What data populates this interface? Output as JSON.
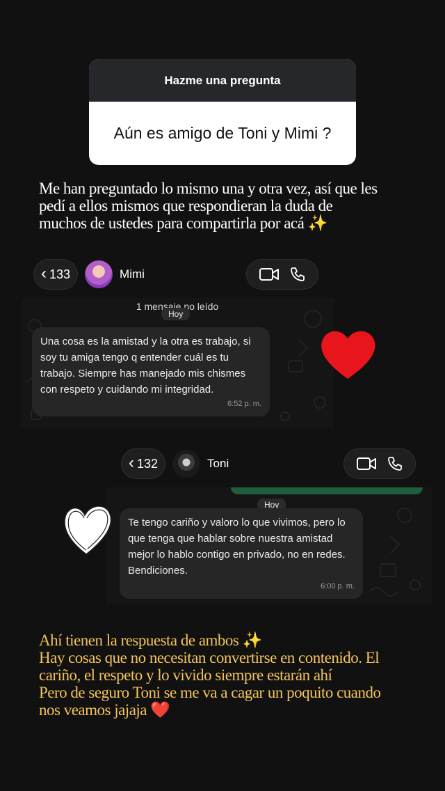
{
  "question_card": {
    "title": "Hazme una pregunta",
    "question": "Aún es amigo de Toni y Mimi ?"
  },
  "intro_caption": {
    "lines": [
      "Me han preguntado lo mismo una y otra vez, así que les",
      "pedí a ellos mismos que respondieran la duda de",
      "muchos de ustedes para compartirla por acá ✨"
    ]
  },
  "chat_mimi": {
    "back_count": "133",
    "contact_name": "Mimi",
    "unread_label": "1 mensaje no leído",
    "day_label": "Hoy",
    "message": "Una cosa es la amistad y la otra es trabajo, si soy tu amiga tengo q entender cuál es tu trabajo. Siempre has manejado mis chismes con respeto y cuidando mi integridad.",
    "time": "6:52 p. m."
  },
  "chat_toni": {
    "back_count": "132",
    "contact_name": "Toni",
    "day_label": "Hoy",
    "message": "Te tengo cariño y valoro lo que vivimos, pero lo que tenga que hablar sobre nuestra amistad mejor lo hablo contigo en privado, no en redes. Bendiciones.",
    "time": "6:00 p. m."
  },
  "closing_caption": {
    "lines": [
      "Ahí tienen la respuesta de ambos ✨",
      "Hay cosas que no necesitan convertirse en contenido. El",
      "cariño, el respeto y lo vivido siempre estarán ahí",
      "Pero de seguro Toni se me va a cagar un poquito cuando",
      "nos veamos jajaja ❤️"
    ]
  },
  "colors": {
    "background": "#111111",
    "caption_gold": "#f3c35a",
    "heart_red": "#e8161c",
    "bubble": "#262626"
  },
  "icons": {
    "back": "chevron-left-icon",
    "video": "video-camera-icon",
    "phone": "phone-icon"
  }
}
